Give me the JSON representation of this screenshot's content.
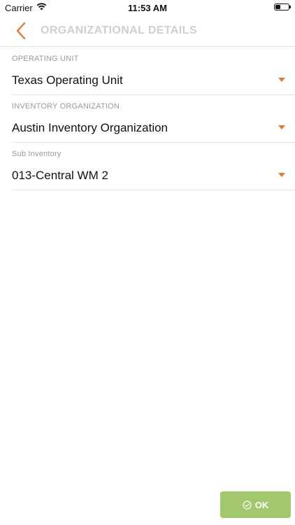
{
  "status_bar": {
    "carrier": "Carrier",
    "time": "11:53 AM",
    "icons": [
      "wifi-icon",
      "battery-icon"
    ]
  },
  "nav": {
    "title": "ORGANIZATIONAL DETAILS",
    "back_icon": "chevron-left-icon"
  },
  "fields": [
    {
      "label": "OPERATING UNIT",
      "value": "Texas Operating Unit"
    },
    {
      "label": "INVENTORY ORGANIZATION",
      "value": "Austin Inventory Organization"
    },
    {
      "label": "Sub Inventory",
      "value": "013-Central WM 2"
    }
  ],
  "ok_button": {
    "label": "OK",
    "icon": "check-circle-icon"
  },
  "colors": {
    "accent": "#e07a2e",
    "title": "#cfcfcf",
    "ok_button": "#a3c86b",
    "label": "#9a9a9a"
  }
}
